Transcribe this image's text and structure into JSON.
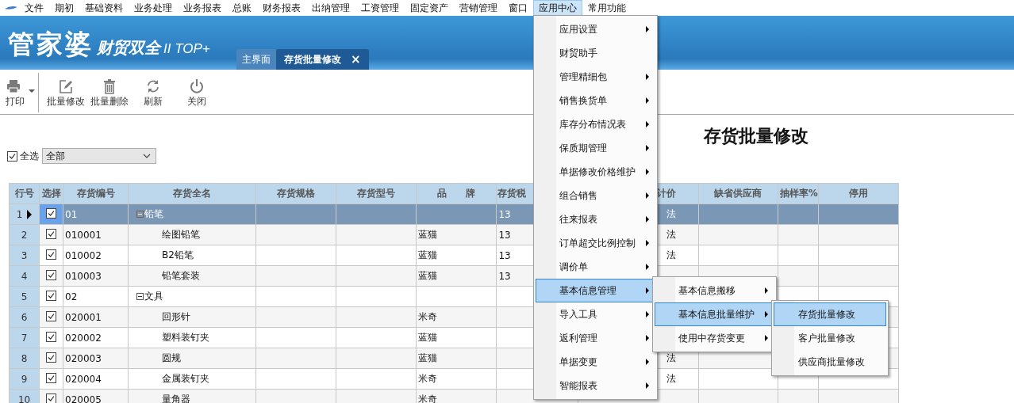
{
  "menubar": [
    {
      "label": "文件",
      "selected": false
    },
    {
      "label": "期初",
      "selected": false
    },
    {
      "label": "基础资料",
      "selected": false
    },
    {
      "label": "业务处理",
      "selected": false
    },
    {
      "label": "业务报表",
      "selected": false
    },
    {
      "label": "总账",
      "selected": false
    },
    {
      "label": "财务报表",
      "selected": false
    },
    {
      "label": "出纳管理",
      "selected": false
    },
    {
      "label": "工资管理",
      "selected": false
    },
    {
      "label": "固定资产",
      "selected": false
    },
    {
      "label": "营销管理",
      "selected": false
    },
    {
      "label": "窗口",
      "selected": false
    },
    {
      "label": "应用中心",
      "selected": true,
      "children": [
        {
          "label": "应用设置",
          "has_submenu": true,
          "selected": false
        },
        {
          "label": "财贸助手",
          "has_submenu": false,
          "selected": false
        },
        {
          "label": "管理精细包",
          "has_submenu": true,
          "selected": false
        },
        {
          "label": "销售换货单",
          "has_submenu": true,
          "selected": false
        },
        {
          "label": "库存分布情况表",
          "has_submenu": true,
          "selected": false
        },
        {
          "label": "保质期管理",
          "has_submenu": true,
          "selected": false
        },
        {
          "label": "单据修改价格维护",
          "has_submenu": true,
          "selected": false
        },
        {
          "label": "组合销售",
          "has_submenu": true,
          "selected": false
        },
        {
          "label": "往来报表",
          "has_submenu": true,
          "selected": false
        },
        {
          "label": "订单超交比例控制",
          "has_submenu": true,
          "selected": false
        },
        {
          "label": "调价单",
          "has_submenu": true,
          "selected": false
        },
        {
          "label": "基本信息管理",
          "has_submenu": true,
          "selected": true,
          "children": [
            {
              "label": "基本信息搬移",
              "has_submenu": true,
              "selected": false
            },
            {
              "label": "基本信息批量维护",
              "has_submenu": true,
              "selected": true,
              "children": [
                {
                  "label": "存货批量修改",
                  "has_submenu": false,
                  "selected": true
                },
                {
                  "label": "客户批量修改",
                  "has_submenu": false,
                  "selected": false
                },
                {
                  "label": "供应商批量修改",
                  "has_submenu": false,
                  "selected": false
                }
              ]
            },
            {
              "label": "使用中存货变更",
              "has_submenu": true,
              "selected": false
            }
          ]
        },
        {
          "label": "导入工具",
          "has_submenu": true,
          "selected": false
        },
        {
          "label": "返利管理",
          "has_submenu": true,
          "selected": false
        },
        {
          "label": "单据变更",
          "has_submenu": true,
          "selected": false
        },
        {
          "label": "智能报表",
          "has_submenu": true,
          "selected": false
        }
      ]
    },
    {
      "label": "常用功能",
      "selected": false
    }
  ],
  "brand": {
    "name": "管家婆",
    "edition": "财贸双全",
    "version": "II TOP+"
  },
  "tabs": [
    {
      "label": "主界面",
      "selected": false,
      "closable": false
    },
    {
      "label": "存货批量修改",
      "selected": true,
      "closable": true,
      "close": "×"
    }
  ],
  "toolbar": [
    {
      "label": "打印",
      "kind": "print",
      "dropdown": true
    },
    {
      "label": "批量修改",
      "kind": "edit",
      "dropdown": false
    },
    {
      "label": "批量删除",
      "kind": "delete",
      "dropdown": false
    },
    {
      "label": "刷新",
      "kind": "refresh",
      "dropdown": false
    },
    {
      "label": "关闭",
      "kind": "power",
      "dropdown": false
    }
  ],
  "page_title": "存货批量修改",
  "filter": {
    "label": "全选",
    "checked": true,
    "value": "全部"
  },
  "table": {
    "columns": [
      "行号",
      "选择",
      "存货编号",
      "存货全名",
      "存货规格",
      "存货型号",
      "品　　牌",
      "存货税",
      "计价",
      "缺省供应商",
      "抽样率%",
      "停用"
    ],
    "rows": [
      {
        "selected": true,
        "checked": true,
        "kind": "group",
        "expanded": true,
        "cells": [
          "1",
          "",
          "01",
          "铅笔",
          "",
          "",
          "",
          "13",
          "法",
          "",
          "",
          ""
        ]
      },
      {
        "selected": false,
        "checked": true,
        "kind": "item",
        "cells": [
          "2",
          "",
          "010001",
          "绘图铅笔",
          "",
          "",
          "蓝猫",
          "13",
          "法",
          "",
          "",
          ""
        ]
      },
      {
        "selected": false,
        "checked": true,
        "kind": "item",
        "cells": [
          "3",
          "",
          "010002",
          "B2铅笔",
          "",
          "",
          "蓝猫",
          "13",
          "法",
          "",
          "",
          ""
        ]
      },
      {
        "selected": false,
        "checked": true,
        "kind": "item",
        "cells": [
          "4",
          "",
          "010003",
          "铅笔套装",
          "",
          "",
          "蓝猫",
          "13",
          "",
          "",
          "",
          ""
        ]
      },
      {
        "selected": false,
        "checked": true,
        "kind": "group",
        "expanded": true,
        "cells": [
          "5",
          "",
          "02",
          "文具",
          "",
          "",
          "",
          "",
          "",
          "",
          "",
          ""
        ]
      },
      {
        "selected": false,
        "checked": true,
        "kind": "item",
        "cells": [
          "6",
          "",
          "020001",
          "回形针",
          "",
          "",
          "米奇",
          "",
          "",
          "",
          "",
          ""
        ]
      },
      {
        "selected": false,
        "checked": true,
        "kind": "item",
        "cells": [
          "7",
          "",
          "020002",
          "塑料装钉夹",
          "",
          "",
          "蓝猫",
          "",
          "",
          "",
          "",
          ""
        ]
      },
      {
        "selected": false,
        "checked": true,
        "kind": "item",
        "cells": [
          "8",
          "",
          "020003",
          "圆规",
          "",
          "",
          "蓝猫",
          "",
          "法",
          "",
          "",
          ""
        ]
      },
      {
        "selected": false,
        "checked": true,
        "kind": "item",
        "cells": [
          "9",
          "",
          "020004",
          "金属装钉夹",
          "",
          "",
          "米奇",
          "",
          "法",
          "",
          "",
          ""
        ]
      },
      {
        "selected": false,
        "checked": true,
        "kind": "item",
        "cells": [
          "10",
          "",
          "020005",
          "量角器",
          "",
          "",
          "米奇",
          "",
          "",
          "",
          "",
          ""
        ]
      }
    ]
  }
}
